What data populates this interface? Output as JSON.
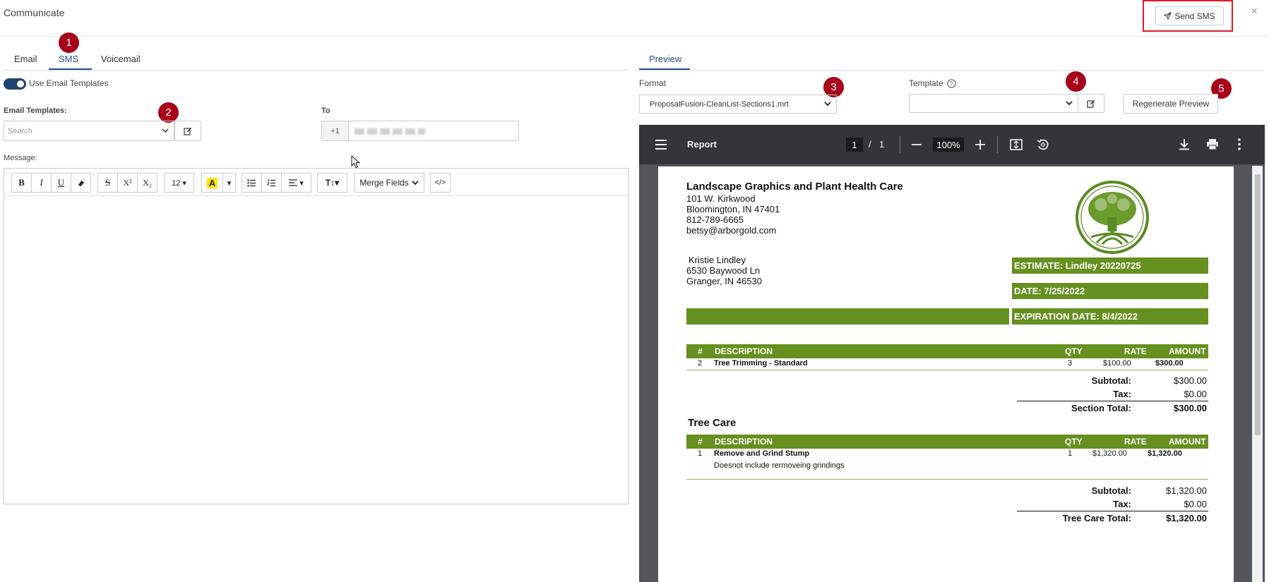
{
  "header": {
    "app_title": "Communicate",
    "send_label": "Send SMS",
    "close_glyph": "×"
  },
  "badges": [
    "1",
    "2",
    "3",
    "4",
    "5"
  ],
  "left_tabs": {
    "email": "Email",
    "sms": "SMS",
    "voicemail": "Voicemail",
    "active": "SMS"
  },
  "toggle": {
    "label": "Use Email Templates",
    "on": true
  },
  "email_templates": {
    "label": "Email Templates:",
    "placeholder": "Search"
  },
  "to": {
    "label": "To",
    "prefix": "+1"
  },
  "message": {
    "label": "Message:"
  },
  "toolbar": {
    "bold": "B",
    "italic": "I",
    "underline": "U",
    "clear_format_icon": "eraser-icon",
    "strike": "S",
    "superscript": "X²",
    "subscript": "X₂",
    "font_size": "12 ▾",
    "highlight": "A",
    "merge_fields": "Merge Fields",
    "code": "</>"
  },
  "preview_tab": "Preview",
  "format": {
    "label": "Format",
    "value": "ProposalFusion-CleanList-Sections1.mrt"
  },
  "template": {
    "label": "Template",
    "value": ""
  },
  "regenerate_label": "Regenerate Preview",
  "viewer": {
    "title": "Report",
    "page_current": "1",
    "page_sep": "/",
    "page_total": "1",
    "zoom": "100%"
  },
  "document": {
    "company": "Landscape Graphics and Plant Health Care",
    "address1": "101 W. Kirkwood",
    "address2": "Bloomington, IN 47401",
    "phone": "812-789-6665",
    "email": "betsy@arborgold.com",
    "client_name": "Kristie Lindley",
    "client_address1": "6530 Baywood Ln",
    "client_address2": "Granger, IN 46530",
    "estimate": "ESTIMATE: Lindley 20220725",
    "date": "DATE: 7/25/2022",
    "expiration": "EXPIRATION DATE:  8/4/2022",
    "columns": {
      "num": "#",
      "desc": "DESCRIPTION",
      "qty": "QTY",
      "rate": "RATE",
      "amount": "AMOUNT"
    },
    "section1": {
      "rows": [
        {
          "num": "2",
          "desc": "Tree Trimming - Standard",
          "qty": "3",
          "rate": "$100.00",
          "amount": "$300.00"
        }
      ],
      "subtotal_label": "Subtotal:",
      "subtotal": "$300.00",
      "tax_label": "Tax:",
      "tax": "$0.00",
      "total_label": "Section Total:",
      "total": "$300.00"
    },
    "section2": {
      "title": "Tree Care",
      "rows": [
        {
          "num": "1",
          "desc": "Remove and Grind Stump",
          "note": "Doesnot include rermoveing grindings",
          "qty": "1",
          "rate": "$1,320.00",
          "amount": "$1,320.00"
        }
      ],
      "subtotal_label": "Subtotal:",
      "subtotal": "$1,320.00",
      "tax_label": "Tax:",
      "tax": "$0.00",
      "total_label": "Tree Care  Total:",
      "total": "$1,320.00"
    }
  },
  "colors": {
    "brand_green": "#66901f",
    "accent_blue": "#2a4a8a",
    "badge_red": "#a8001a",
    "highlight_red": "#e01b24"
  }
}
